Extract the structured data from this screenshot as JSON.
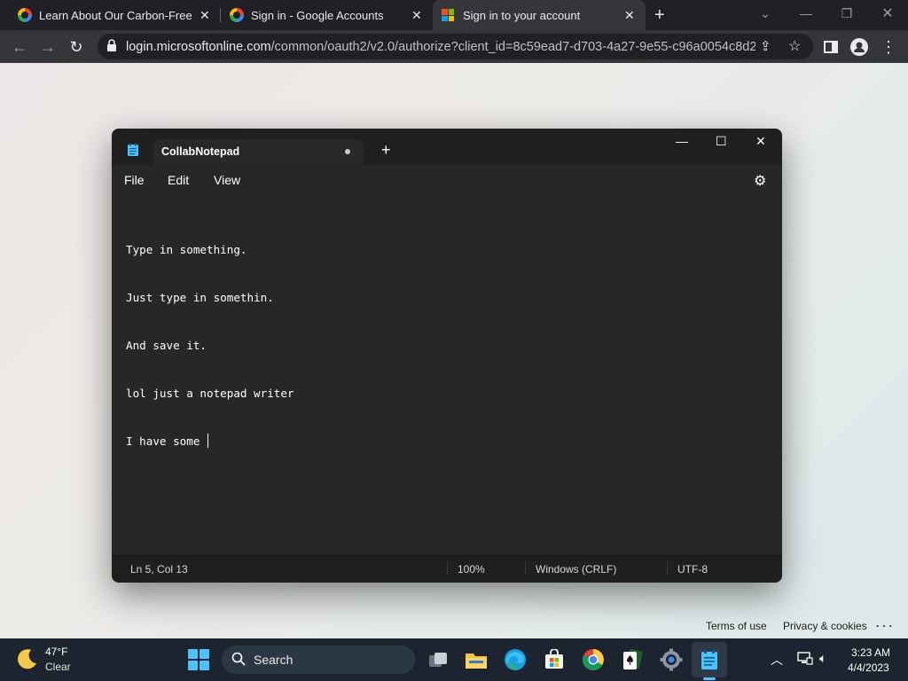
{
  "browser": {
    "tabs": [
      {
        "title": "Learn About Our Carbon-Free Go",
        "favicon": "google-icon"
      },
      {
        "title": "Sign in - Google Accounts",
        "favicon": "google-icon"
      },
      {
        "title": "Sign in to your account",
        "favicon": "microsoft-icon",
        "active": true
      }
    ],
    "url_host": "login.microsoftonline.com",
    "url_path": "/common/oauth2/v2.0/authorize?client_id=8c59ead7-d703-4a27-9e55-c96a0054c8d2..."
  },
  "page": {
    "footer_links": [
      "Terms of use",
      "Privacy & cookies",
      "· · ·"
    ]
  },
  "notepad": {
    "tab_title": "CollabNotepad",
    "menu": [
      "File",
      "Edit",
      "View"
    ],
    "lines": [
      "Type in something.",
      "Just type in somethin.",
      "And save it.",
      "lol just a notepad writer",
      "I have some "
    ],
    "status": {
      "position": "Ln 5, Col 13",
      "zoom": "100%",
      "line_ending": "Windows (CRLF)",
      "encoding": "UTF-8"
    }
  },
  "taskbar": {
    "weather_temp": "47°F",
    "weather_cond": "Clear",
    "search_label": "Search",
    "time": "3:23 AM",
    "date": "4/4/2023",
    "apps": [
      "task-view",
      "file-explorer",
      "edge",
      "microsoft-store",
      "chrome",
      "solitaire",
      "settings",
      "notepad"
    ]
  },
  "colors": {
    "chrome_bg": "#202124",
    "notepad_bg": "#272727",
    "taskbar_bg": "#1c2430",
    "accent": "#4cc2ff"
  }
}
